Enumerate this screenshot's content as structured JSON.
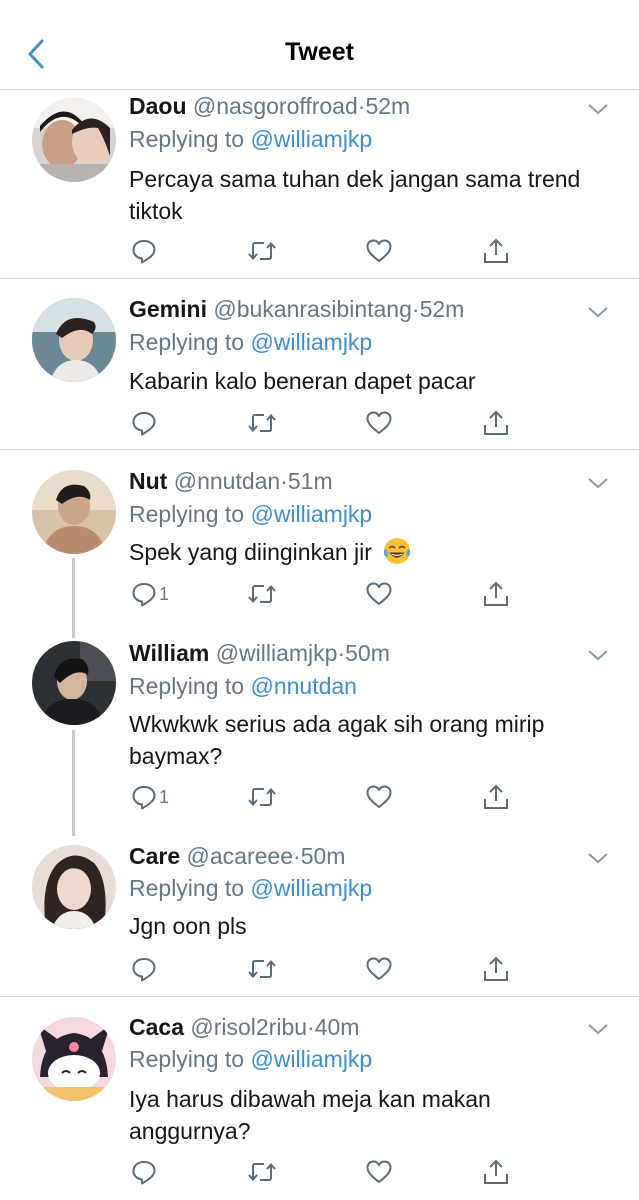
{
  "header": {
    "title": "Tweet",
    "back_icon": "chevron-left-icon",
    "accent": "#3b8fd1"
  },
  "reply_prefix": "Replying to ",
  "tweets": [
    {
      "name": "Daou",
      "handle": "@nasgoroffroad",
      "time": "52m",
      "reply_to": "@williamjkp",
      "text": "Percaya sama tuhan dek jangan sama trend tiktok",
      "reply_count": ""
    },
    {
      "name": "Gemini",
      "handle": "@bukanrasibintang",
      "time": "52m",
      "reply_to": "@williamjkp",
      "text": "Kabarin kalo beneran dapet pacar",
      "reply_count": ""
    },
    {
      "name": "Nut",
      "handle": "@nnutdan",
      "time": "51m",
      "reply_to": "@williamjkp",
      "text": "Spek yang diinginkan jir",
      "emoji": "face-with-tears-of-joy",
      "reply_count": "1"
    },
    {
      "name": "William",
      "handle": "@williamjkp",
      "time": "50m",
      "reply_to": "@nnutdan",
      "text": "Wkwkwk serius ada agak sih orang mirip baymax?",
      "reply_count": "1"
    },
    {
      "name": "Care",
      "handle": "@acareee",
      "time": "50m",
      "reply_to": "@williamjkp",
      "text": "Jgn oon pls",
      "reply_count": ""
    },
    {
      "name": "Caca",
      "handle": "@risol2ribu",
      "time": "40m",
      "reply_to": "@williamjkp",
      "text": "Iya harus dibawah meja kan makan anggurnya?",
      "reply_count": ""
    }
  ],
  "action_icons": [
    "reply-icon",
    "retweet-icon",
    "like-icon",
    "share-icon"
  ]
}
